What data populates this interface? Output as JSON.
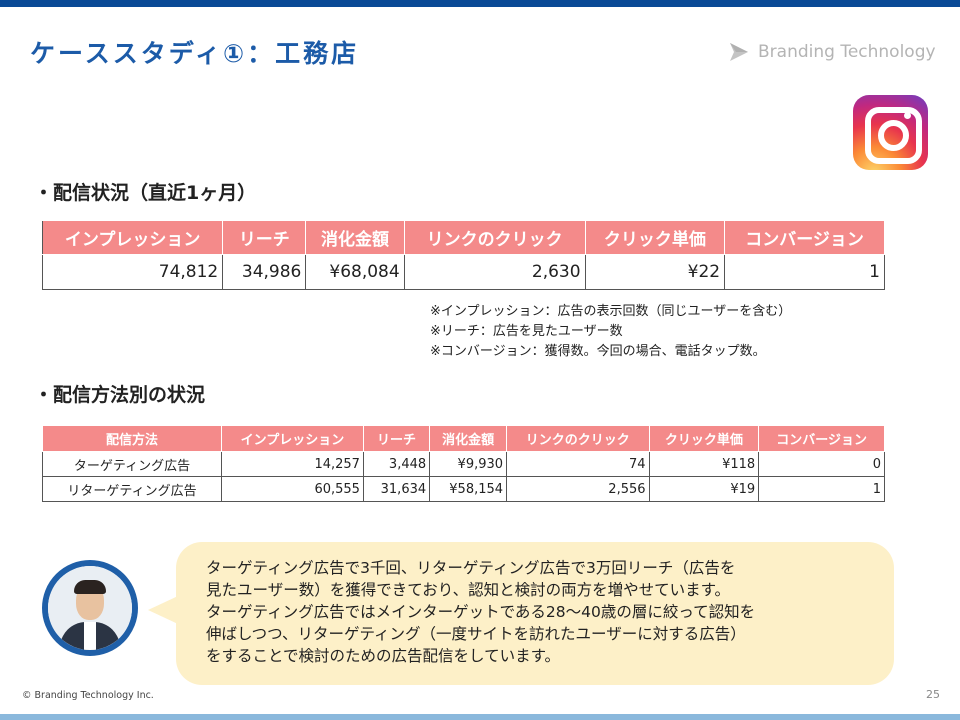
{
  "slide": {
    "title": "ケーススタディ①：工務店",
    "logo_text": "Branding Technology",
    "footer": "© Branding Technology Inc.",
    "page_number": "25"
  },
  "section1": {
    "heading": "・配信状況（直近1ヶ月）",
    "headers": [
      "インプレッション",
      "リーチ",
      "消化金額",
      "リンクのクリック",
      "クリック単価",
      "コンバージョン"
    ],
    "values": [
      "74,812",
      "34,986",
      "¥68,084",
      "2,630",
      "¥22",
      "1"
    ]
  },
  "notes": [
    "※インプレッション：広告の表示回数（同じユーザーを含む）",
    "※リーチ：広告を見たユーザー数",
    "※コンバージョン：獲得数。今回の場合、電話タップ数。"
  ],
  "section2": {
    "heading": "・配信方法別の状況",
    "headers": [
      "配信方法",
      "インプレッション",
      "リーチ",
      "消化金額",
      "リンクのクリック",
      "クリック単価",
      "コンバージョン"
    ],
    "rows": [
      [
        "ターゲティング広告",
        "14,257",
        "3,448",
        "¥9,930",
        "74",
        "¥118",
        "0"
      ],
      [
        "リターゲティング広告",
        "60,555",
        "31,634",
        "¥58,154",
        "2,556",
        "¥19",
        "1"
      ]
    ]
  },
  "comment": {
    "lines": [
      "ターゲティング広告で3千回、リターゲティング広告で3万回リーチ（広告を",
      "見たユーザー数）を獲得できており、認知と検討の両方を増やせています。",
      "ターゲティング広告ではメインターゲットである28〜40歳の層に絞って認知を",
      "伸ばしつつ、リターゲティング（一度サイトを訪れたユーザーに対する広告）",
      "をすることで検討のための広告配信をしています。"
    ]
  },
  "colors": {
    "title": "#1c5ba8",
    "table_header": "#f48a8a",
    "bubble": "#fdf0c8",
    "top_bar": "#0a4a96",
    "avatar_ring": "#1f5fa8"
  },
  "icons": {
    "logo": "branding-technology-logo-icon",
    "social": "instagram-icon"
  }
}
